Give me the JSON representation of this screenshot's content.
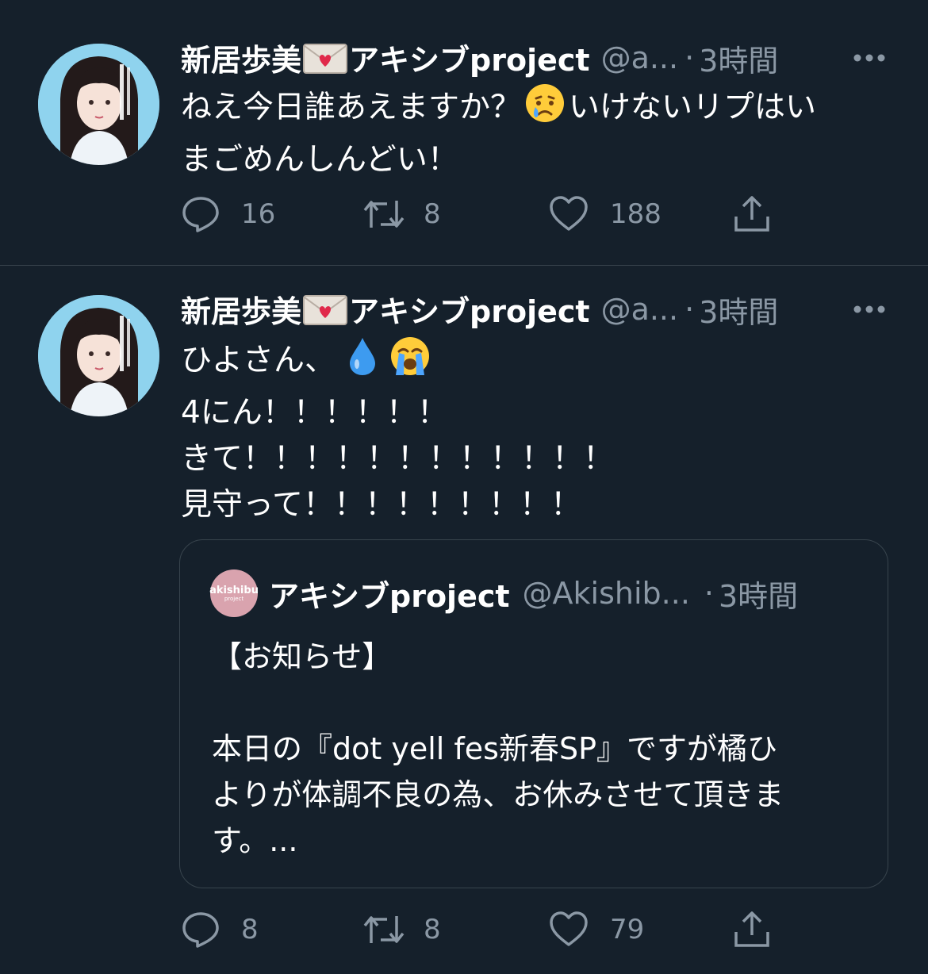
{
  "tweets": [
    {
      "display_name": "新居歩美",
      "display_name_suffix": "アキシブproject",
      "handle": "@a...",
      "separator": "·",
      "time": "3時間",
      "body_lines": [
        {
          "before": "ねえ今日誰あえますか？",
          "emoji": "crying-face-emoji",
          "after": "いけないリプはい"
        },
        {
          "before": "まごめんしんどい！",
          "emoji": "",
          "after": ""
        }
      ],
      "actions": {
        "reply": "16",
        "retweet": "8",
        "like": "188"
      }
    },
    {
      "display_name": "新居歩美",
      "display_name_suffix": "アキシブproject",
      "handle": "@a...",
      "separator": "·",
      "time": "3時間",
      "body_lines": [
        "ひよさん、",
        "4にん！！！！！！",
        "きて！！！！！！！！！！！！",
        "見守って！！！！！！！！！"
      ],
      "body_emojis": [
        "droplet-emoji",
        "loudly-crying-face-emoji"
      ],
      "quote": {
        "avatar_text": "akishibu",
        "avatar_subtext": "project",
        "name": "アキシブproject",
        "handle": "@Akishib...",
        "separator": "·",
        "time": "3時間",
        "body_lines": [
          "【お知らせ】",
          "",
          "本日の『dot yell fes新春SP』ですが橘ひ",
          "よりが体調不良の為、お休みさせて頂きま",
          "す。..."
        ]
      },
      "actions": {
        "reply": "8",
        "retweet": "8",
        "like": "79"
      }
    }
  ],
  "colors": {
    "background": "#15202b",
    "text": "#ffffff",
    "secondary": "#8b98a5",
    "divider": "#38444d"
  }
}
